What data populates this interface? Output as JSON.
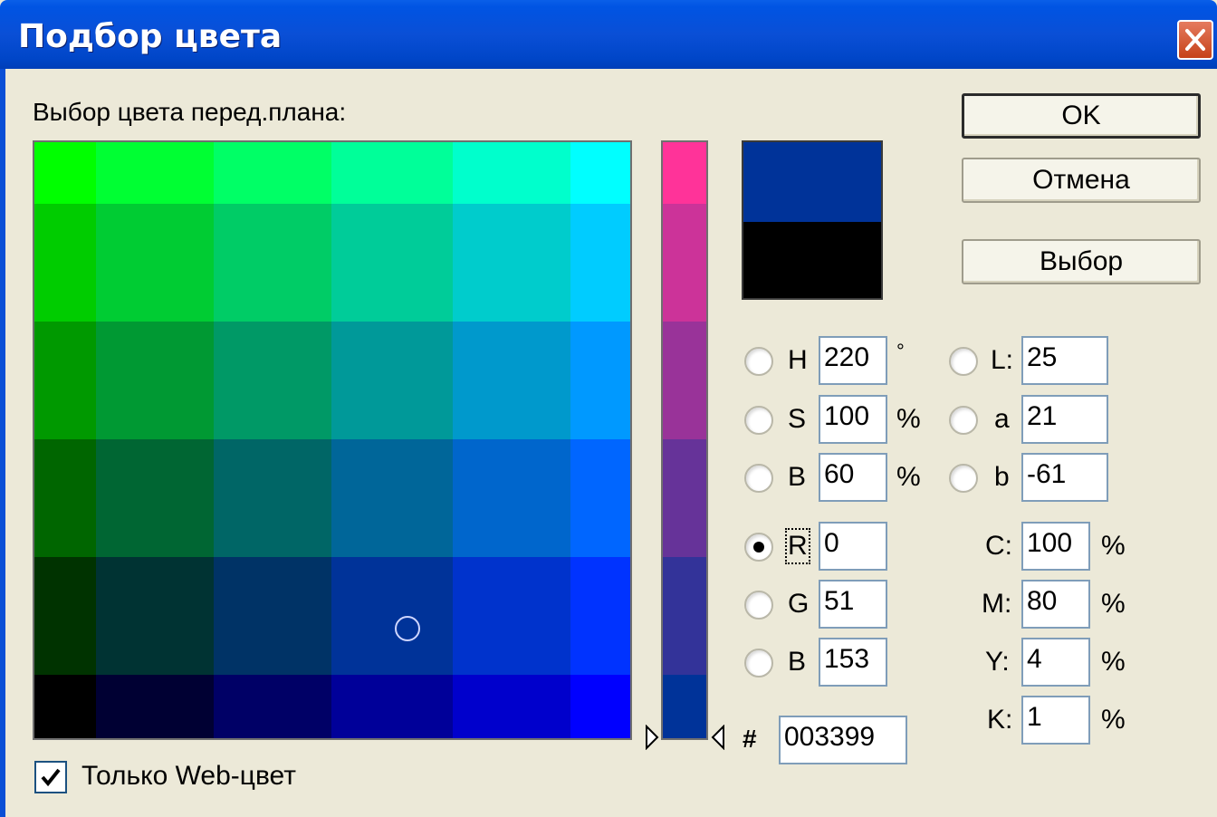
{
  "window": {
    "title": "Подбор цвета"
  },
  "labels": {
    "foreground": "Выбор цвета перед.плана:",
    "web_only": "Только Web-цвет",
    "hex_prefix": "#"
  },
  "buttons": {
    "ok": "OK",
    "cancel": "Отмена",
    "pick": "Выбор"
  },
  "colors": {
    "new_color": "#003399",
    "old_color": "#000000",
    "field": [
      [
        "#00ff00",
        "#00ff33",
        "#00ff66",
        "#00ff99",
        "#00ffcc",
        "#00ffff"
      ],
      [
        "#00cc00",
        "#00cc33",
        "#00cc66",
        "#00cc99",
        "#00cccc",
        "#00ccff"
      ],
      [
        "#009900",
        "#009933",
        "#009966",
        "#009999",
        "#0099cc",
        "#0099ff"
      ],
      [
        "#006600",
        "#006633",
        "#006666",
        "#006699",
        "#0066cc",
        "#0066ff"
      ],
      [
        "#003300",
        "#003333",
        "#003366",
        "#003399",
        "#0033cc",
        "#0033ff"
      ],
      [
        "#000000",
        "#000033",
        "#000066",
        "#000099",
        "#0000cc",
        "#0000ff"
      ]
    ],
    "slider": [
      "#ff3399",
      "#cc3399",
      "#993399",
      "#663399",
      "#333399",
      "#003399"
    ]
  },
  "hsb": {
    "h": {
      "label": "H",
      "value": "220",
      "unit": "°"
    },
    "s": {
      "label": "S",
      "value": "100",
      "unit": "%"
    },
    "b": {
      "label": "B",
      "value": "60",
      "unit": "%"
    }
  },
  "lab": {
    "l": {
      "label": "L:",
      "value": "25"
    },
    "a": {
      "label": "a",
      "value": "21"
    },
    "b": {
      "label": "b",
      "value": "-61"
    }
  },
  "rgb": {
    "r": {
      "label": "R",
      "value": "0"
    },
    "g": {
      "label": "G",
      "value": "51"
    },
    "b": {
      "label": "B",
      "value": "153"
    }
  },
  "cmyk": {
    "c": {
      "label": "C:",
      "value": "100",
      "unit": "%"
    },
    "m": {
      "label": "M:",
      "value": "80",
      "unit": "%"
    },
    "y": {
      "label": "Y:",
      "value": "4",
      "unit": "%"
    },
    "k": {
      "label": "K:",
      "value": "1",
      "unit": "%"
    }
  },
  "hex": {
    "value": "003399"
  },
  "selected_mode": "R",
  "web_only_checked": true
}
